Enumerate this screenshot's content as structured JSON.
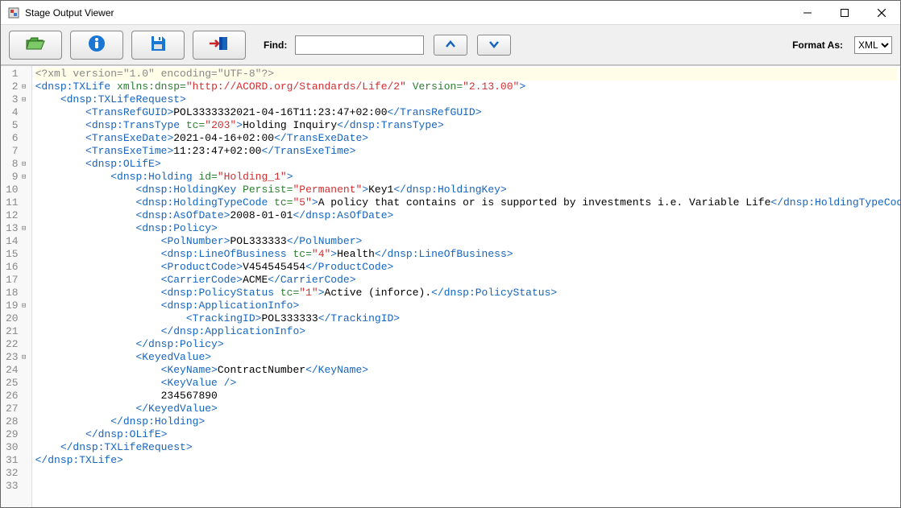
{
  "window": {
    "title": "Stage Output Viewer"
  },
  "toolbar": {
    "find_label": "Find:",
    "find_value": "",
    "format_label": "Format As:",
    "format_selected": "XML",
    "format_options": [
      "XML"
    ]
  },
  "code": {
    "lines": [
      {
        "n": 1,
        "hl": true,
        "fold": "",
        "segs": [
          {
            "c": "decl",
            "t": "<?xml version=\"1.0\" encoding=\"UTF-8\"?>"
          }
        ]
      },
      {
        "n": 2,
        "fold": "⊟",
        "segs": [
          {
            "c": "tag",
            "t": "<dnsp:TXLife"
          },
          {
            "c": "attr",
            "t": " xmlns:dnsp="
          },
          {
            "c": "str",
            "t": "\"http://ACORD.org/Standards/Life/2\""
          },
          {
            "c": "attr",
            "t": " Version="
          },
          {
            "c": "str",
            "t": "\"2.13.00\""
          },
          {
            "c": "tag",
            "t": ">"
          }
        ]
      },
      {
        "n": 3,
        "fold": "⊟",
        "segs": [
          {
            "c": "txt",
            "t": "    "
          },
          {
            "c": "tag",
            "t": "<dnsp:TXLifeRequest>"
          }
        ]
      },
      {
        "n": 4,
        "fold": "",
        "segs": [
          {
            "c": "txt",
            "t": "        "
          },
          {
            "c": "tag",
            "t": "<TransRefGUID>"
          },
          {
            "c": "txt",
            "t": "POL3333332021-04-16T11:23:47+02:00"
          },
          {
            "c": "tag",
            "t": "</TransRefGUID>"
          }
        ]
      },
      {
        "n": 5,
        "fold": "",
        "segs": [
          {
            "c": "txt",
            "t": "        "
          },
          {
            "c": "tag",
            "t": "<dnsp:TransType"
          },
          {
            "c": "attr",
            "t": " tc="
          },
          {
            "c": "str",
            "t": "\"203\""
          },
          {
            "c": "tag",
            "t": ">"
          },
          {
            "c": "txt",
            "t": "Holding Inquiry"
          },
          {
            "c": "tag",
            "t": "</dnsp:TransType>"
          }
        ]
      },
      {
        "n": 6,
        "fold": "",
        "segs": [
          {
            "c": "txt",
            "t": "        "
          },
          {
            "c": "tag",
            "t": "<TransExeDate>"
          },
          {
            "c": "txt",
            "t": "2021-04-16+02:00"
          },
          {
            "c": "tag",
            "t": "</TransExeDate>"
          }
        ]
      },
      {
        "n": 7,
        "fold": "",
        "segs": [
          {
            "c": "txt",
            "t": "        "
          },
          {
            "c": "tag",
            "t": "<TransExeTime>"
          },
          {
            "c": "txt",
            "t": "11:23:47+02:00"
          },
          {
            "c": "tag",
            "t": "</TransExeTime>"
          }
        ]
      },
      {
        "n": 8,
        "fold": "⊟",
        "segs": [
          {
            "c": "txt",
            "t": "        "
          },
          {
            "c": "tag",
            "t": "<dnsp:OLifE>"
          }
        ]
      },
      {
        "n": 9,
        "fold": "⊟",
        "segs": [
          {
            "c": "txt",
            "t": "            "
          },
          {
            "c": "tag",
            "t": "<dnsp:Holding"
          },
          {
            "c": "attr",
            "t": " id="
          },
          {
            "c": "str",
            "t": "\"Holding_1\""
          },
          {
            "c": "tag",
            "t": ">"
          }
        ]
      },
      {
        "n": 10,
        "fold": "",
        "segs": [
          {
            "c": "txt",
            "t": "                "
          },
          {
            "c": "tag",
            "t": "<dnsp:HoldingKey"
          },
          {
            "c": "attr",
            "t": " Persist="
          },
          {
            "c": "str",
            "t": "\"Permanent\""
          },
          {
            "c": "tag",
            "t": ">"
          },
          {
            "c": "txt",
            "t": "Key1"
          },
          {
            "c": "tag",
            "t": "</dnsp:HoldingKey>"
          }
        ]
      },
      {
        "n": 11,
        "fold": "",
        "segs": [
          {
            "c": "txt",
            "t": "                "
          },
          {
            "c": "tag",
            "t": "<dnsp:HoldingTypeCode"
          },
          {
            "c": "attr",
            "t": " tc="
          },
          {
            "c": "str",
            "t": "\"5\""
          },
          {
            "c": "tag",
            "t": ">"
          },
          {
            "c": "txt",
            "t": "A policy that contains or is supported by investments i.e. Variable Life"
          },
          {
            "c": "tag",
            "t": "</dnsp:HoldingTypeCode>"
          }
        ]
      },
      {
        "n": 12,
        "fold": "",
        "segs": [
          {
            "c": "txt",
            "t": "                "
          },
          {
            "c": "tag",
            "t": "<dnsp:AsOfDate>"
          },
          {
            "c": "txt",
            "t": "2008-01-01"
          },
          {
            "c": "tag",
            "t": "</dnsp:AsOfDate>"
          }
        ]
      },
      {
        "n": 13,
        "fold": "⊟",
        "segs": [
          {
            "c": "txt",
            "t": "                "
          },
          {
            "c": "tag",
            "t": "<dnsp:Policy>"
          }
        ]
      },
      {
        "n": 14,
        "fold": "",
        "segs": [
          {
            "c": "txt",
            "t": "                    "
          },
          {
            "c": "tag",
            "t": "<PolNumber>"
          },
          {
            "c": "txt",
            "t": "POL333333"
          },
          {
            "c": "tag",
            "t": "</PolNumber>"
          }
        ]
      },
      {
        "n": 15,
        "fold": "",
        "segs": [
          {
            "c": "txt",
            "t": "                    "
          },
          {
            "c": "tag",
            "t": "<dnsp:LineOfBusiness"
          },
          {
            "c": "attr",
            "t": " tc="
          },
          {
            "c": "str",
            "t": "\"4\""
          },
          {
            "c": "tag",
            "t": ">"
          },
          {
            "c": "txt",
            "t": "Health"
          },
          {
            "c": "tag",
            "t": "</dnsp:LineOfBusiness>"
          }
        ]
      },
      {
        "n": 16,
        "fold": "",
        "segs": [
          {
            "c": "txt",
            "t": "                    "
          },
          {
            "c": "tag",
            "t": "<ProductCode>"
          },
          {
            "c": "txt",
            "t": "V454545454"
          },
          {
            "c": "tag",
            "t": "</ProductCode>"
          }
        ]
      },
      {
        "n": 17,
        "fold": "",
        "segs": [
          {
            "c": "txt",
            "t": "                    "
          },
          {
            "c": "tag",
            "t": "<CarrierCode>"
          },
          {
            "c": "txt",
            "t": "ACME"
          },
          {
            "c": "tag",
            "t": "</CarrierCode>"
          }
        ]
      },
      {
        "n": 18,
        "fold": "",
        "segs": [
          {
            "c": "txt",
            "t": "                    "
          },
          {
            "c": "tag",
            "t": "<dnsp:PolicyStatus"
          },
          {
            "c": "attr",
            "t": " tc="
          },
          {
            "c": "str",
            "t": "\"1\""
          },
          {
            "c": "tag",
            "t": ">"
          },
          {
            "c": "txt",
            "t": "Active (inforce)."
          },
          {
            "c": "tag",
            "t": "</dnsp:PolicyStatus>"
          }
        ]
      },
      {
        "n": 19,
        "fold": "⊟",
        "segs": [
          {
            "c": "txt",
            "t": "                    "
          },
          {
            "c": "tag",
            "t": "<dnsp:ApplicationInfo>"
          }
        ]
      },
      {
        "n": 20,
        "fold": "",
        "segs": [
          {
            "c": "txt",
            "t": "                        "
          },
          {
            "c": "tag",
            "t": "<TrackingID>"
          },
          {
            "c": "txt",
            "t": "POL333333"
          },
          {
            "c": "tag",
            "t": "</TrackingID>"
          }
        ]
      },
      {
        "n": 21,
        "fold": "",
        "segs": [
          {
            "c": "txt",
            "t": "                    "
          },
          {
            "c": "tag",
            "t": "</dnsp:ApplicationInfo>"
          }
        ]
      },
      {
        "n": 22,
        "fold": "",
        "segs": [
          {
            "c": "txt",
            "t": "                "
          },
          {
            "c": "tag",
            "t": "</dnsp:Policy>"
          }
        ]
      },
      {
        "n": 23,
        "fold": "⊟",
        "segs": [
          {
            "c": "txt",
            "t": "                "
          },
          {
            "c": "tag",
            "t": "<KeyedValue>"
          }
        ]
      },
      {
        "n": 24,
        "fold": "",
        "segs": [
          {
            "c": "txt",
            "t": "                    "
          },
          {
            "c": "tag",
            "t": "<KeyName>"
          },
          {
            "c": "txt",
            "t": "ContractNumber"
          },
          {
            "c": "tag",
            "t": "</KeyName>"
          }
        ]
      },
      {
        "n": 25,
        "fold": "",
        "segs": [
          {
            "c": "txt",
            "t": "                    "
          },
          {
            "c": "tag",
            "t": "<KeyValue />"
          }
        ]
      },
      {
        "n": 26,
        "fold": "",
        "segs": [
          {
            "c": "txt",
            "t": "                    234567890"
          }
        ]
      },
      {
        "n": 27,
        "fold": "",
        "segs": [
          {
            "c": "txt",
            "t": "                "
          },
          {
            "c": "tag",
            "t": "</KeyedValue>"
          }
        ]
      },
      {
        "n": 28,
        "fold": "",
        "segs": [
          {
            "c": "txt",
            "t": "            "
          },
          {
            "c": "tag",
            "t": "</dnsp:Holding>"
          }
        ]
      },
      {
        "n": 29,
        "fold": "",
        "segs": [
          {
            "c": "txt",
            "t": "        "
          },
          {
            "c": "tag",
            "t": "</dnsp:OLifE>"
          }
        ]
      },
      {
        "n": 30,
        "fold": "",
        "segs": [
          {
            "c": "txt",
            "t": "    "
          },
          {
            "c": "tag",
            "t": "</dnsp:TXLifeRequest>"
          }
        ]
      },
      {
        "n": 31,
        "fold": "",
        "segs": [
          {
            "c": "tag",
            "t": "</dnsp:TXLife>"
          }
        ]
      },
      {
        "n": 32,
        "fold": "",
        "segs": []
      },
      {
        "n": 33,
        "fold": "",
        "segs": []
      }
    ]
  }
}
